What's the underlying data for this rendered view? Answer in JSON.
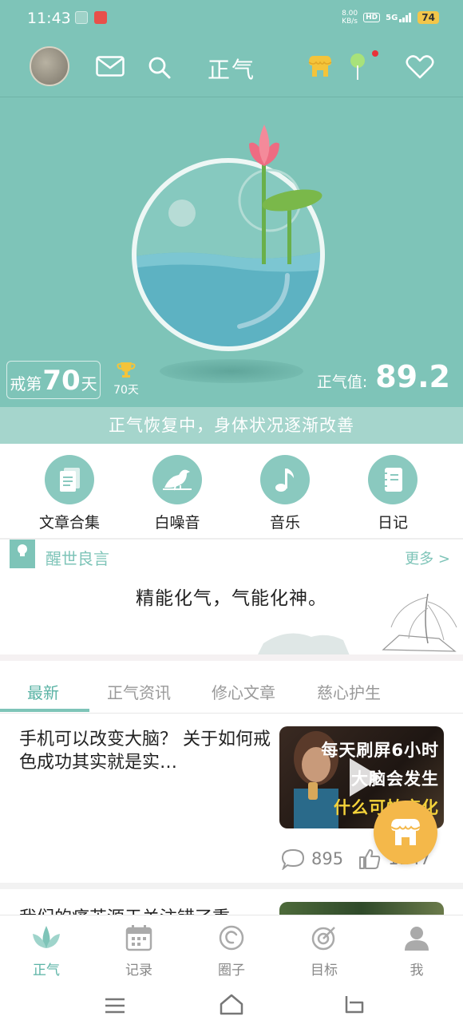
{
  "status_bar": {
    "time": "11:43",
    "net_speed_value": "8.00",
    "net_speed_unit": "KB/s",
    "hd": "HD",
    "signal": "5G",
    "battery": "74"
  },
  "header": {
    "title": "正气",
    "icons": [
      "avatar",
      "mail-icon",
      "search-icon",
      "shop-icon",
      "tree-icon",
      "heart-icon"
    ]
  },
  "hero": {
    "days_prefix": "戒第",
    "days_value": "70",
    "days_suffix": "天",
    "trophy_text": "70天",
    "score_label": "正气值:",
    "score_value": "89.2",
    "status_message": "正气恢复中，身体状况逐渐改善"
  },
  "quick_actions": [
    {
      "label": "文章合集",
      "icon": "document-icon"
    },
    {
      "label": "白噪音",
      "icon": "bird-icon"
    },
    {
      "label": "音乐",
      "icon": "music-note-icon"
    },
    {
      "label": "日记",
      "icon": "notebook-icon"
    }
  ],
  "quote": {
    "header": "醒世良言",
    "more": "更多 >",
    "text": "精能化气，气能化神。"
  },
  "tabs": [
    "最新",
    "正气资讯",
    "修心文章",
    "慈心护生"
  ],
  "active_tab": "最新",
  "article": {
    "title": "手机可以改变大脑？ 关于如何戒色成功其实就是实…",
    "thumb_caption_1": "每天刷屏6小时",
    "thumb_caption_2": "大脑会发生",
    "thumb_caption_3": "什么可怕变化",
    "comments": "895",
    "likes": "1147"
  },
  "article2": {
    "title": "我们的痛苦源于关注错了重"
  },
  "bottom_nav": [
    {
      "label": "正气",
      "icon": "lotus-icon",
      "active": true
    },
    {
      "label": "记录",
      "icon": "calendar-icon",
      "active": false
    },
    {
      "label": "圈子",
      "icon": "circle-icon",
      "active": false
    },
    {
      "label": "目标",
      "icon": "target-icon",
      "active": false
    },
    {
      "label": "我",
      "icon": "user-icon",
      "active": false
    }
  ],
  "colors": {
    "primary": "#7ec4b8",
    "accent": "#5ab3a5",
    "fab": "#f4b84a",
    "lotus": "#f07a8a",
    "leaf": "#7ab84a"
  }
}
